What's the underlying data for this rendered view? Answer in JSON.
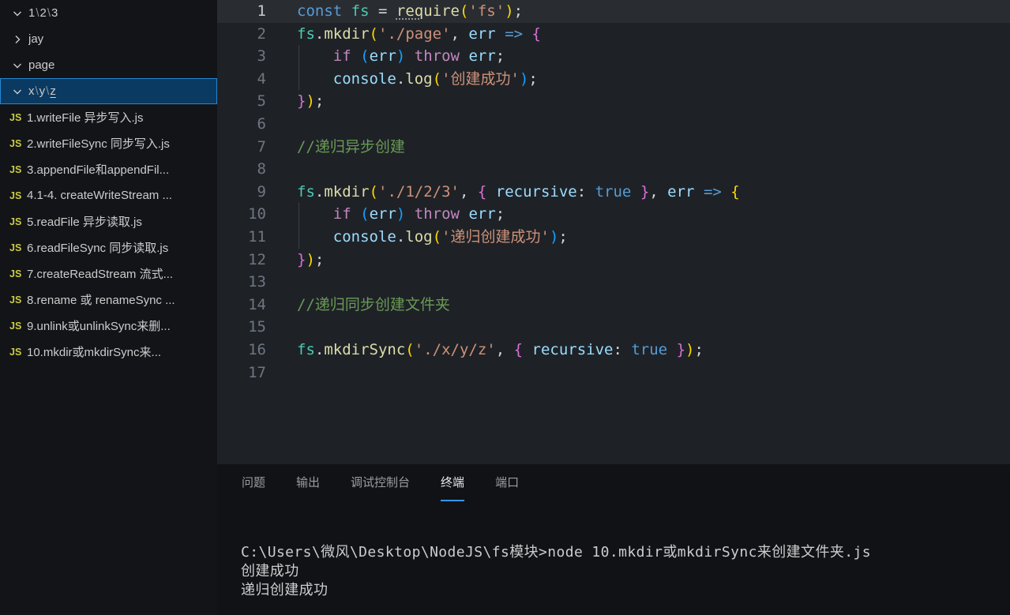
{
  "sidebar": {
    "separator": "\\",
    "folders": [
      {
        "name": "1-2-3",
        "segments": [
          "1",
          "2",
          "3"
        ],
        "chevron": "down",
        "selected": false
      },
      {
        "name": "jay",
        "segments": [
          "jay"
        ],
        "chevron": "right",
        "selected": false
      },
      {
        "name": "page",
        "segments": [
          "page"
        ],
        "chevron": "down",
        "selected": false
      },
      {
        "name": "x-y-z",
        "segments": [
          "x",
          "y",
          "z"
        ],
        "chevron": "down",
        "selected": true,
        "underline_last": true
      }
    ],
    "file_icon_text": "JS",
    "files": [
      "1.writeFile 异步写入.js",
      "2.writeFileSync 同步写入.js",
      "3.appendFile和appendFil...",
      "4.1-4. createWriteStream ...",
      "5.readFile 异步读取.js",
      "6.readFileSync 同步读取.js",
      "7.createReadStream 流式...",
      "8.rename 或 renameSync ...",
      "9.unlink或unlinkSync来删...",
      "10.mkdir或mkdirSync来..."
    ]
  },
  "editor": {
    "lines": [
      {
        "n": 1,
        "active": true,
        "seg": [
          [
            "const",
            "kw"
          ],
          [
            " ",
            "pn"
          ],
          [
            "fs",
            "mod"
          ],
          [
            " = ",
            "pn"
          ],
          [
            "req",
            "fn",
            "u"
          ],
          [
            "uire",
            "fn"
          ],
          [
            "(",
            "b1"
          ],
          [
            "'fs'",
            "str"
          ],
          [
            ")",
            "b1"
          ],
          [
            ";",
            "pn"
          ]
        ]
      },
      {
        "n": 2,
        "seg": [
          [
            "fs",
            "mod"
          ],
          [
            ".",
            "pn"
          ],
          [
            "mkdir",
            "fn"
          ],
          [
            "(",
            "b1"
          ],
          [
            "'./page'",
            "str"
          ],
          [
            ", ",
            "pn"
          ],
          [
            "err",
            "var"
          ],
          [
            " ",
            "pn"
          ],
          [
            "=>",
            "kw"
          ],
          [
            " ",
            "pn"
          ],
          [
            "{",
            "b2"
          ]
        ]
      },
      {
        "n": 3,
        "guide": true,
        "seg": [
          [
            "    ",
            "pn"
          ],
          [
            "if",
            "ctrl"
          ],
          [
            " ",
            "pn"
          ],
          [
            "(",
            "b3"
          ],
          [
            "err",
            "var"
          ],
          [
            ")",
            "b3"
          ],
          [
            " ",
            "pn"
          ],
          [
            "throw",
            "ctrl"
          ],
          [
            " ",
            "pn"
          ],
          [
            "err",
            "var"
          ],
          [
            ";",
            "pn"
          ]
        ]
      },
      {
        "n": 4,
        "guide": true,
        "seg": [
          [
            "    ",
            "pn"
          ],
          [
            "console",
            "var"
          ],
          [
            ".",
            "pn"
          ],
          [
            "log",
            "fn"
          ],
          [
            "(",
            "b1"
          ],
          [
            "'创建成功'",
            "str"
          ],
          [
            ")",
            "b3"
          ],
          [
            ";",
            "pn"
          ]
        ]
      },
      {
        "n": 5,
        "seg": [
          [
            "}",
            "b2"
          ],
          [
            ")",
            "b1"
          ],
          [
            ";",
            "pn"
          ]
        ]
      },
      {
        "n": 6,
        "seg": []
      },
      {
        "n": 7,
        "seg": [
          [
            "//递归异步创建",
            "cm"
          ]
        ]
      },
      {
        "n": 8,
        "seg": []
      },
      {
        "n": 9,
        "seg": [
          [
            "fs",
            "mod"
          ],
          [
            ".",
            "pn"
          ],
          [
            "mkdir",
            "fn"
          ],
          [
            "(",
            "b1"
          ],
          [
            "'./1/2/3'",
            "str"
          ],
          [
            ", ",
            "pn"
          ],
          [
            "{",
            "b2"
          ],
          [
            " ",
            "pn"
          ],
          [
            "recursive",
            "var"
          ],
          [
            ":",
            "pn"
          ],
          [
            " ",
            "pn"
          ],
          [
            "true",
            "kw"
          ],
          [
            " ",
            "pn"
          ],
          [
            "}",
            "b2"
          ],
          [
            ", ",
            "pn"
          ],
          [
            "err",
            "var"
          ],
          [
            " ",
            "pn"
          ],
          [
            "=>",
            "kw"
          ],
          [
            " ",
            "pn"
          ],
          [
            "{",
            "b1"
          ]
        ]
      },
      {
        "n": 10,
        "guide": true,
        "seg": [
          [
            "    ",
            "pn"
          ],
          [
            "if",
            "ctrl"
          ],
          [
            " ",
            "pn"
          ],
          [
            "(",
            "b3"
          ],
          [
            "err",
            "var"
          ],
          [
            ")",
            "b3"
          ],
          [
            " ",
            "pn"
          ],
          [
            "throw",
            "ctrl"
          ],
          [
            " ",
            "pn"
          ],
          [
            "err",
            "var"
          ],
          [
            ";",
            "pn"
          ]
        ]
      },
      {
        "n": 11,
        "guide": true,
        "seg": [
          [
            "    ",
            "pn"
          ],
          [
            "console",
            "var"
          ],
          [
            ".",
            "pn"
          ],
          [
            "log",
            "fn"
          ],
          [
            "(",
            "b1"
          ],
          [
            "'递归创建成功'",
            "str"
          ],
          [
            ")",
            "b3"
          ],
          [
            ";",
            "pn"
          ]
        ]
      },
      {
        "n": 12,
        "seg": [
          [
            "}",
            "b2"
          ],
          [
            ")",
            "b1"
          ],
          [
            ";",
            "pn"
          ]
        ]
      },
      {
        "n": 13,
        "seg": []
      },
      {
        "n": 14,
        "seg": [
          [
            "//递归同步创建文件夹",
            "cm"
          ]
        ]
      },
      {
        "n": 15,
        "seg": []
      },
      {
        "n": 16,
        "seg": [
          [
            "fs",
            "mod"
          ],
          [
            ".",
            "pn"
          ],
          [
            "mkdirSync",
            "fn"
          ],
          [
            "(",
            "b1"
          ],
          [
            "'./x/y/z'",
            "str"
          ],
          [
            ", ",
            "pn"
          ],
          [
            "{",
            "b2"
          ],
          [
            " ",
            "pn"
          ],
          [
            "recursive",
            "var"
          ],
          [
            ":",
            "pn"
          ],
          [
            " ",
            "pn"
          ],
          [
            "true",
            "kw"
          ],
          [
            " ",
            "pn"
          ],
          [
            "}",
            "b2"
          ],
          [
            ")",
            "b1"
          ],
          [
            ";",
            "pn"
          ]
        ]
      },
      {
        "n": 17,
        "seg": []
      }
    ]
  },
  "panel": {
    "tabs": [
      {
        "name": "problems",
        "label": "问题",
        "active": false
      },
      {
        "name": "output",
        "label": "输出",
        "active": false
      },
      {
        "name": "debug-console",
        "label": "调试控制台",
        "active": false
      },
      {
        "name": "terminal",
        "label": "终端",
        "active": true
      },
      {
        "name": "ports",
        "label": "端口",
        "active": false
      }
    ],
    "terminal_lines": [
      "C:\\Users\\微风\\Desktop\\NodeJS\\fs模块>node 10.mkdir或mkdirSync来创建文件夹.js",
      "创建成功",
      "递归创建成功"
    ]
  },
  "colors": {
    "sidebar_bg": "#121418",
    "editor_bg": "#1e2227",
    "panel_bg": "#101216",
    "selection_bg": "#0a3a61",
    "selection_border": "#2486d3",
    "tab_active_underline": "#3794ff",
    "js_icon": "#cbcb41",
    "comment": "#6a9955",
    "keyword": "#569cd6",
    "control": "#c586c0",
    "function": "#dcdcaa",
    "string": "#ce9178",
    "variable": "#9cdcfe",
    "module": "#4ec9b0",
    "bracket_gold": "#ffd700",
    "bracket_orchid": "#da70d6",
    "bracket_blue": "#179fff",
    "terminal_text": "#cccccc",
    "line_number": "#6e7681"
  }
}
